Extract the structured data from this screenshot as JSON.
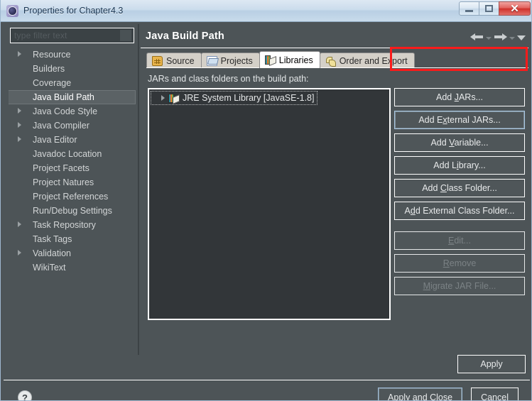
{
  "window": {
    "title": "Properties for Chapter4.3",
    "icon": "eclipse-icon",
    "buttons": {
      "minimize": "minimize-icon",
      "maximize": "restore-icon",
      "close": "close-icon"
    }
  },
  "sidebar": {
    "filter": {
      "placeholder": "type filter text",
      "value": ""
    },
    "items": [
      {
        "label": "Resource",
        "expandable": true,
        "selected": false
      },
      {
        "label": "Builders",
        "expandable": false,
        "selected": false
      },
      {
        "label": "Coverage",
        "expandable": false,
        "selected": false
      },
      {
        "label": "Java Build Path",
        "expandable": false,
        "selected": true
      },
      {
        "label": "Java Code Style",
        "expandable": true,
        "selected": false
      },
      {
        "label": "Java Compiler",
        "expandable": true,
        "selected": false
      },
      {
        "label": "Java Editor",
        "expandable": true,
        "selected": false
      },
      {
        "label": "Javadoc Location",
        "expandable": false,
        "selected": false
      },
      {
        "label": "Project Facets",
        "expandable": false,
        "selected": false
      },
      {
        "label": "Project Natures",
        "expandable": false,
        "selected": false
      },
      {
        "label": "Project References",
        "expandable": false,
        "selected": false
      },
      {
        "label": "Run/Debug Settings",
        "expandable": false,
        "selected": false
      },
      {
        "label": "Task Repository",
        "expandable": true,
        "selected": false
      },
      {
        "label": "Task Tags",
        "expandable": false,
        "selected": false
      },
      {
        "label": "Validation",
        "expandable": true,
        "selected": false
      },
      {
        "label": "WikiText",
        "expandable": false,
        "selected": false
      }
    ]
  },
  "page": {
    "title": "Java Build Path",
    "nav": {
      "back": "back-arrow-icon",
      "back_menu": "back-dropdown-icon",
      "forward": "forward-arrow-icon",
      "forward_menu": "forward-dropdown-icon",
      "menu": "view-menu-icon"
    },
    "tabs": [
      {
        "label": "Source",
        "icon": "source-folder-icon",
        "active": false
      },
      {
        "label": "Projects",
        "icon": "projects-folder-icon",
        "active": false
      },
      {
        "label": "Libraries",
        "icon": "libraries-books-icon",
        "active": true
      },
      {
        "label": "Order and Export",
        "icon": "order-export-icon",
        "active": false
      }
    ],
    "list_label": "JARs and class folders on the build path:",
    "list_items": [
      {
        "label": "JRE System Library [JavaSE-1.8]",
        "icon": "jre-library-icon",
        "expandable": true,
        "focused": true
      }
    ],
    "side_buttons": [
      {
        "label": "Add JARs...",
        "mnemonic": "J",
        "enabled": true,
        "highlighted": false
      },
      {
        "label": "Add External JARs...",
        "mnemonic": "x",
        "enabled": true,
        "highlighted": true
      },
      {
        "label": "Add Variable...",
        "mnemonic": "V",
        "enabled": true,
        "highlighted": false
      },
      {
        "label": "Add Library...",
        "mnemonic": "i",
        "enabled": true,
        "highlighted": false
      },
      {
        "label": "Add Class Folder...",
        "mnemonic": "C",
        "enabled": true,
        "highlighted": false
      },
      {
        "label": "Add External Class Folder...",
        "mnemonic": "d",
        "enabled": true,
        "highlighted": false
      },
      {
        "label": "Edit...",
        "mnemonic": "E",
        "enabled": false,
        "highlighted": false
      },
      {
        "label": "Remove",
        "mnemonic": "R",
        "enabled": false,
        "highlighted": false
      },
      {
        "label": "Migrate JAR File...",
        "mnemonic": "M",
        "enabled": false,
        "highlighted": false
      }
    ],
    "apply_label": "Apply"
  },
  "footer": {
    "help": "?",
    "apply_and_close": "Apply and Close",
    "cancel": "Cancel"
  },
  "colors": {
    "highlight_box": "#fb1b1b",
    "dialog_bg": "#4d5457",
    "list_bg": "#323639",
    "accent_tab_active": "#ffffff"
  }
}
